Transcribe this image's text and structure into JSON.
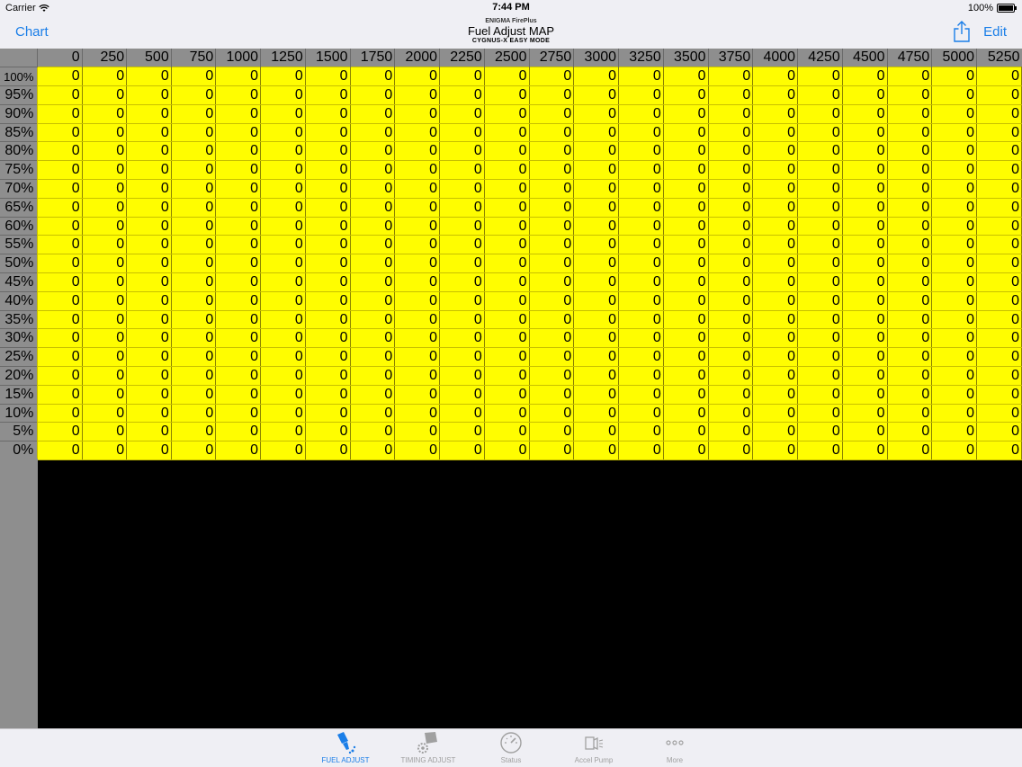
{
  "status_bar": {
    "carrier": "Carrier",
    "time": "7:44 PM",
    "battery": "100%"
  },
  "nav": {
    "app_name": "ENIGMA FirePlus",
    "title": "Fuel Adjust MAP",
    "subtitle": "CYGNUS-X EASY MODE",
    "left_button": "Chart",
    "right_button": "Edit",
    "share_icon": "share-icon"
  },
  "table": {
    "columns": [
      "0",
      "250",
      "500",
      "750",
      "1000",
      "1250",
      "1500",
      "1750",
      "2000",
      "2250",
      "2500",
      "2750",
      "3000",
      "3250",
      "3500",
      "3750",
      "4000",
      "4250",
      "4500",
      "4750",
      "5000",
      "5250"
    ],
    "rows": [
      "100%",
      "95%",
      "90%",
      "85%",
      "80%",
      "75%",
      "70%",
      "65%",
      "60%",
      "55%",
      "50%",
      "45%",
      "40%",
      "35%",
      "30%",
      "25%",
      "20%",
      "15%",
      "10%",
      "5%",
      "0%"
    ],
    "cell_value": "0",
    "cell_color": "#fffd00",
    "header_color": "#8e8e8e"
  },
  "tabs": [
    {
      "label": "FUEL ADJUST",
      "icon": "fuel-injector-icon",
      "active": true
    },
    {
      "label": "TIMING ADJUST",
      "icon": "timing-gear-icon",
      "active": false
    },
    {
      "label": "Status",
      "icon": "gauge-icon",
      "active": false
    },
    {
      "label": "Accel Pump",
      "icon": "accel-pump-icon",
      "active": false
    },
    {
      "label": "More",
      "icon": "more-dots-icon",
      "active": false
    }
  ],
  "accent_color": "#1a7ee8"
}
